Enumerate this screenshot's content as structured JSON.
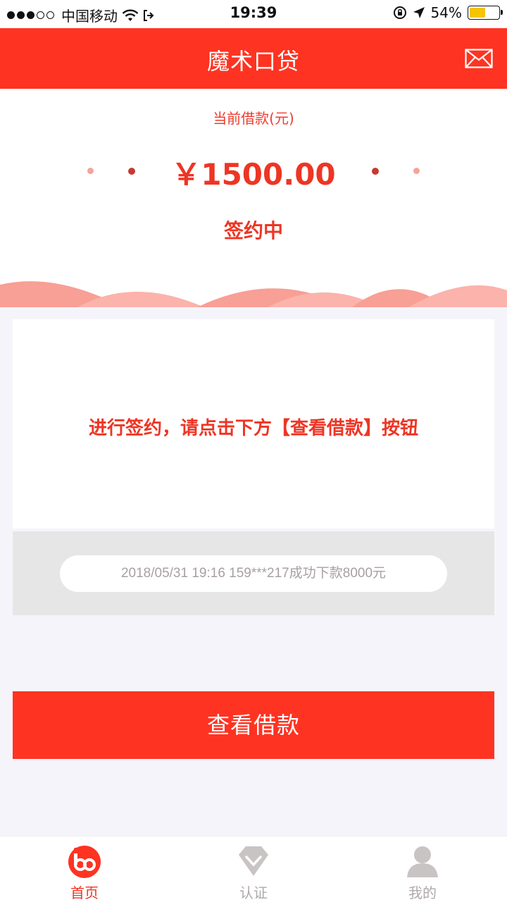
{
  "status_bar": {
    "carrier": "中国移动",
    "time": "19:39",
    "battery_percent": "54%",
    "battery_level": 0.54,
    "icons": [
      "wifi-icon",
      "call-forward-icon",
      "rotation-lock-icon",
      "location-arrow-icon",
      "battery-icon"
    ]
  },
  "header": {
    "title": "魔术口贷",
    "mail_icon": "mail-icon"
  },
  "loan": {
    "label": "当前借款(元)",
    "amount": "￥1500.00",
    "status": "签约中"
  },
  "message": {
    "text": "进行签约，请点击下方【查看借款】按钮"
  },
  "ticker": {
    "text": "2018/05/31 19:16 159***217成功下款8000元"
  },
  "action": {
    "button_label": "查看借款"
  },
  "tabs": [
    {
      "label": "首页",
      "icon": "home-logo-icon",
      "active": true
    },
    {
      "label": "认证",
      "icon": "diamond-icon",
      "active": false
    },
    {
      "label": "我的",
      "icon": "user-icon",
      "active": false
    }
  ],
  "colors": {
    "brand_red": "#ff3322",
    "text_red": "#ee3524",
    "inactive_gray": "#c9c4c4",
    "ticker_text": "#a8a0a0",
    "battery_yellow": "#f6c500"
  }
}
